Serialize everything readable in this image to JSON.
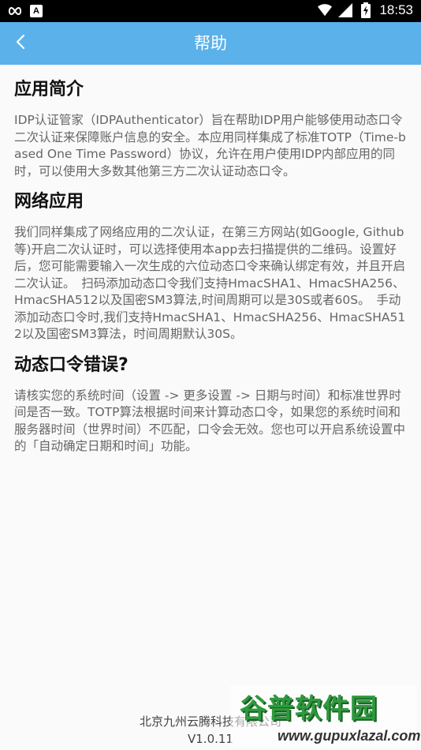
{
  "status_bar": {
    "time": "18:53",
    "left_icons": [
      "infinity-icon",
      "a-box-icon"
    ],
    "right_icons": [
      "wifi-icon",
      "cellular-signal-icon",
      "battery-charging-icon"
    ]
  },
  "app_bar": {
    "title": "帮助",
    "color": "#5bb1ea"
  },
  "sections": [
    {
      "title": "应用简介",
      "body": "IDP认证管家（IDPAuthenticator）旨在帮助IDP用户能够使用动态口令二次认证来保障账户信息的安全。本应用同样集成了标准TOTP（Time-based One Time Password）协议，允许在用户使用IDP内部应用的同时，可以使用大多数其他第三方二次认证动态口令。"
    },
    {
      "title": "网络应用",
      "body": "我们同样集成了网络应用的二次认证，在第三方网站(如Google, Github等)开启二次认证时，可以选择使用本app去扫描提供的二维码。设置好后，您可能需要输入一次生成的六位动态口令来确认绑定有效，并且开启二次认证。　扫码添加动态口令我们支持HmacSHA1、HmacSHA256、HmacSHA512以及国密SM3算法,时间周期可以是30S或者60S。　手动添加动态口令时,我们支持HmacSHA1、HmacSHA256、HmacSHA512以及国密SM3算法，时间周期默认30S。"
    },
    {
      "title": "动态口令错误?",
      "body": "请核实您的系统时间（设置 -> 更多设置 -> 日期与时间）和标准世界时间是否一致。TOTP算法根据时间来计算动态口令，如果您的系统时间和服务器时间（世界时间）不匹配，口令会无效。您也可以开启系统设置中的「自动确定日期和时间」功能。"
    }
  ],
  "footer": {
    "company": "北京九州云腾科技有限公司",
    "version": "V1.0.11"
  },
  "watermark": {
    "title": "谷普软件园",
    "url": "www.gupuxlazal.com"
  }
}
